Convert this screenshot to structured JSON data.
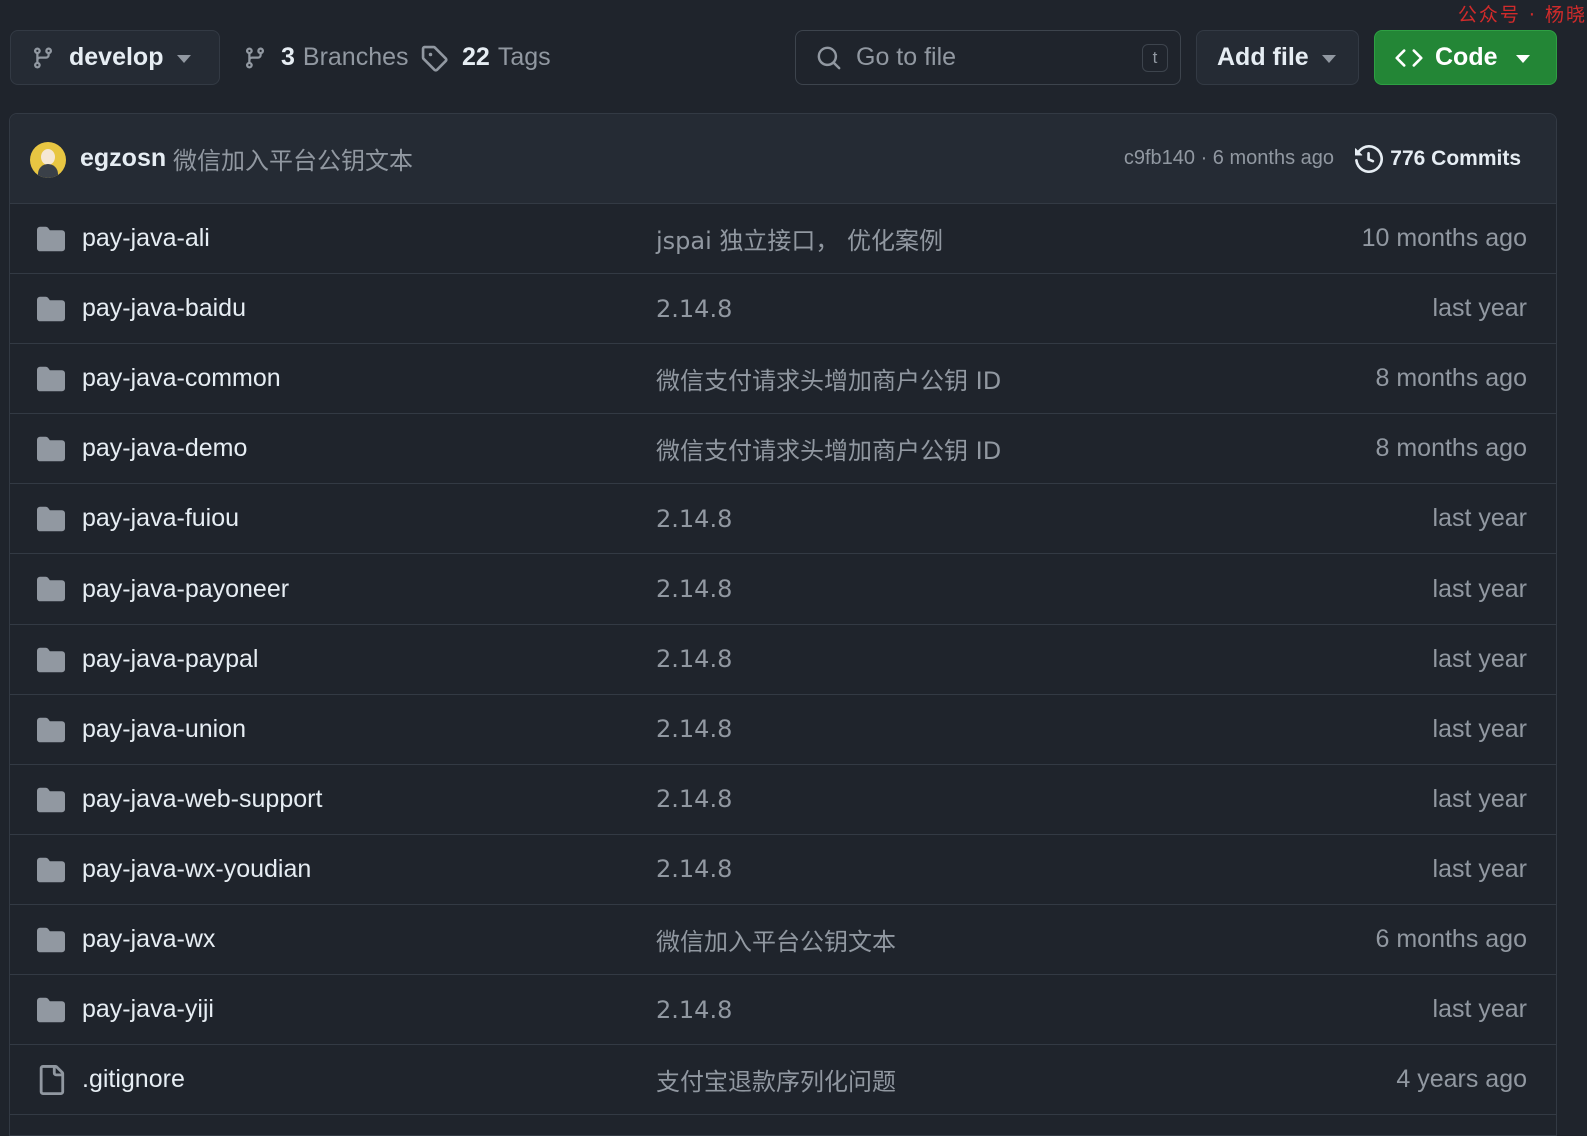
{
  "toolbar": {
    "branch": "develop",
    "branches_count": "3",
    "branches_label": "Branches",
    "tags_count": "22",
    "tags_label": "Tags",
    "search_placeholder": "Go to file",
    "search_shortcut": "t",
    "add_file_label": "Add file",
    "code_label": "Code",
    "watermark": "公众号 · 杨晓"
  },
  "latest_commit": {
    "author": "egzosn",
    "message": "微信加入平台公钥文本",
    "hash_time": "c9fb140 · 6 months ago",
    "commits_label": "776 Commits"
  },
  "files": [
    {
      "type": "folder",
      "name": "pay-java-ali",
      "message": "jspai 独立接口， 优化案例",
      "date": "10 months ago"
    },
    {
      "type": "folder",
      "name": "pay-java-baidu",
      "message": "2.14.8",
      "date": "last year"
    },
    {
      "type": "folder",
      "name": "pay-java-common",
      "message": "微信支付请求头增加商户公钥 ID",
      "date": "8 months ago"
    },
    {
      "type": "folder",
      "name": "pay-java-demo",
      "message": "微信支付请求头增加商户公钥 ID",
      "date": "8 months ago"
    },
    {
      "type": "folder",
      "name": "pay-java-fuiou",
      "message": "2.14.8",
      "date": "last year"
    },
    {
      "type": "folder",
      "name": "pay-java-payoneer",
      "message": "2.14.8",
      "date": "last year"
    },
    {
      "type": "folder",
      "name": "pay-java-paypal",
      "message": "2.14.8",
      "date": "last year"
    },
    {
      "type": "folder",
      "name": "pay-java-union",
      "message": "2.14.8",
      "date": "last year"
    },
    {
      "type": "folder",
      "name": "pay-java-web-support",
      "message": "2.14.8",
      "date": "last year"
    },
    {
      "type": "folder",
      "name": "pay-java-wx-youdian",
      "message": "2.14.8",
      "date": "last year"
    },
    {
      "type": "folder",
      "name": "pay-java-wx",
      "message": "微信加入平台公钥文本",
      "date": "6 months ago"
    },
    {
      "type": "folder",
      "name": "pay-java-yiji",
      "message": "2.14.8",
      "date": "last year"
    },
    {
      "type": "file",
      "name": ".gitignore",
      "message": "支付宝退款序列化问题",
      "date": "4 years ago"
    }
  ],
  "colors": {
    "background": "#1f242c",
    "code_button": "#238636",
    "folder_icon": "#9198a1"
  }
}
